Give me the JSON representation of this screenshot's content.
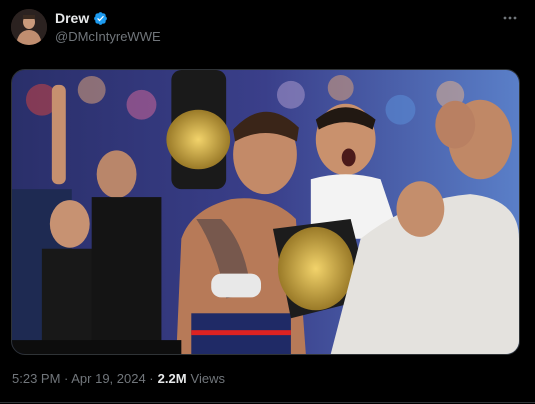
{
  "author": {
    "display_name": "Drew",
    "handle": "@DMcIntyreWWE",
    "verified": true,
    "avatar_icon": "profile-avatar"
  },
  "post": {
    "image_icon": "post-photo",
    "timestamp": "5:23 PM · Apr 19, 2024 ·",
    "views_count": "2.2M",
    "views_label": "Views"
  },
  "colors": {
    "background": "#000000",
    "verified_badge": "#1d9bf0",
    "secondary_text": "#71767b"
  }
}
